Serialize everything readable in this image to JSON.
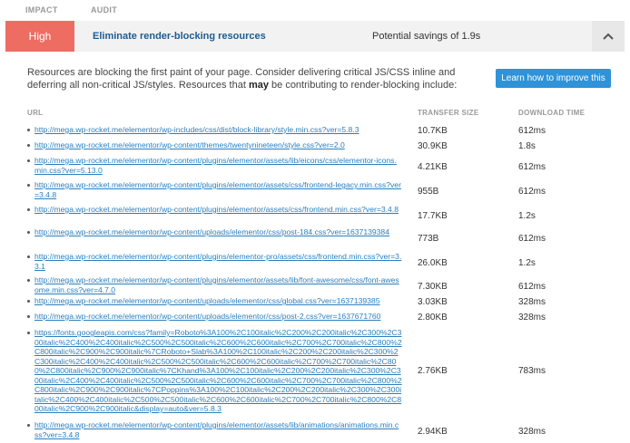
{
  "header": {
    "impact": "IMPACT",
    "audit": "AUDIT"
  },
  "audit_row": {
    "impact": "High",
    "title": "Eliminate render-blocking resources",
    "savings": "Potential savings of 1.9s",
    "impact_color": "#ee6d63"
  },
  "description": {
    "part1": "Resources are blocking the first paint of your page. Consider delivering critical JS/CSS inline and deferring all non-critical JS/styles. Resources that ",
    "bold": "may",
    "part2": " be contributing to render-blocking include:"
  },
  "learn_button": "Learn how to improve this",
  "table": {
    "col_url": "URL",
    "col_size": "TRANSFER SIZE",
    "col_time": "DOWNLOAD TIME",
    "rows": [
      {
        "url": "http://mega.wp-rocket.me/elementor/wp-includes/css/dist/block-library/style.min.css?ver=5.8.3",
        "size": "10.7KB",
        "time": "612ms"
      },
      {
        "url": "http://mega.wp-rocket.me/elementor/wp-content/themes/twentynineteen/style.css?ver=2.0",
        "size": "30.9KB",
        "time": "1.8s"
      },
      {
        "url": "http://mega.wp-rocket.me/elementor/wp-content/plugins/elementor/assets/lib/eicons/css/elementor-icons.min.css?ver=5.13.0",
        "size": "4.21KB",
        "time": "612ms"
      },
      {
        "url": "http://mega.wp-rocket.me/elementor/wp-content/plugins/elementor/assets/css/frontend-legacy.min.css?ver=3.4.8",
        "size": "955B",
        "time": "612ms"
      },
      {
        "url": "http://mega.wp-rocket.me/elementor/wp-content/plugins/elementor/assets/css/frontend.min.css?ver=3.4.8",
        "size": "17.7KB",
        "time": "1.2s"
      },
      {
        "url": "http://mega.wp-rocket.me/elementor/wp-content/uploads/elementor/css/post-184.css?ver=1637139384",
        "size": "773B",
        "time": "612ms"
      },
      {
        "url": "http://mega.wp-rocket.me/elementor/wp-content/plugins/elementor-pro/assets/css/frontend.min.css?ver=3.3.1",
        "size": "26.0KB",
        "time": "1.2s"
      },
      {
        "url": "http://mega.wp-rocket.me/elementor/wp-content/plugins/elementor/assets/lib/font-awesome/css/font-awesome.min.css?ver=4.7.0",
        "size": "7.30KB",
        "time": "612ms"
      },
      {
        "url": "http://mega.wp-rocket.me/elementor/wp-content/uploads/elementor/css/global.css?ver=1637139385",
        "size": "3.03KB",
        "time": "328ms"
      },
      {
        "url": "http://mega.wp-rocket.me/elementor/wp-content/uploads/elementor/css/post-2.css?ver=1637671760",
        "size": "2.80KB",
        "time": "328ms"
      },
      {
        "url": "https://fonts.googleapis.com/css?family=Roboto%3A100%2C100italic%2C200%2C200italic%2C300%2C300italic%2C400%2C400italic%2C500%2C500italic%2C600%2C600italic%2C700%2C700italic%2C800%2C800italic%2C900%2C900italic%7CRoboto+Slab%3A100%2C100italic%2C200%2C200italic%2C300%2C300italic%2C400%2C400italic%2C500%2C500italic%2C600%2C600italic%2C700%2C700italic%2C800%2C800italic%2C900%2C900italic%7CKhand%3A100%2C100italic%2C200%2C200italic%2C300%2C300italic%2C400%2C400italic%2C500%2C500italic%2C600%2C600italic%2C700%2C700italic%2C800%2C800italic%2C900%2C900italic%7CPoppins%3A100%2C100italic%2C200%2C200italic%2C300%2C300italic%2C400%2C400italic%2C500%2C500italic%2C600%2C600italic%2C700%2C700italic%2C800%2C800italic%2C900%2C900italic&display=auto&ver=5.8.3",
        "size": "2.76KB",
        "time": "783ms"
      },
      {
        "url": "http://mega.wp-rocket.me/elementor/wp-content/plugins/elementor/assets/lib/animations/animations.min.css?ver=3.4.8",
        "size": "2.94KB",
        "time": "328ms"
      }
    ]
  }
}
